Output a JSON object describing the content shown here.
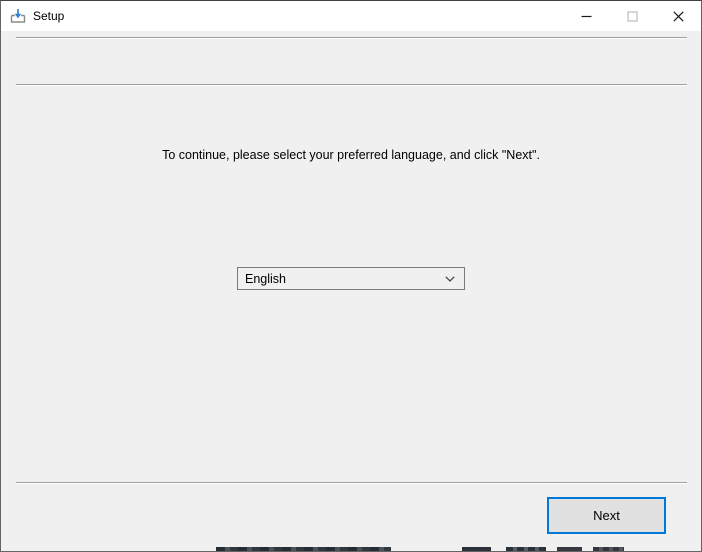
{
  "window": {
    "title": "Setup"
  },
  "titlebar": {
    "app_icon": "install-download-tray-icon",
    "minimize_icon": "minimize-icon",
    "maximize_icon": "maximize-icon",
    "close_icon": "close-icon",
    "maximize_disabled": true
  },
  "main": {
    "instruction": "To continue, please select your preferred language, and click \"Next\".",
    "language_dropdown": {
      "selected": "English",
      "dropdown_icon": "chevron-down-icon"
    },
    "next_button_label": "Next"
  },
  "colors": {
    "accent": "#0078d7",
    "titlebar_bg": "#ffffff",
    "window_bg": "#f0f0f0",
    "button_bg": "#e1e1e1",
    "control_border": "#7a7a7a",
    "separator": "#a0a0a0",
    "window_border": "#646464",
    "arrow_blue": "#2f7fd6",
    "tray_gray": "#8a8a8a"
  }
}
